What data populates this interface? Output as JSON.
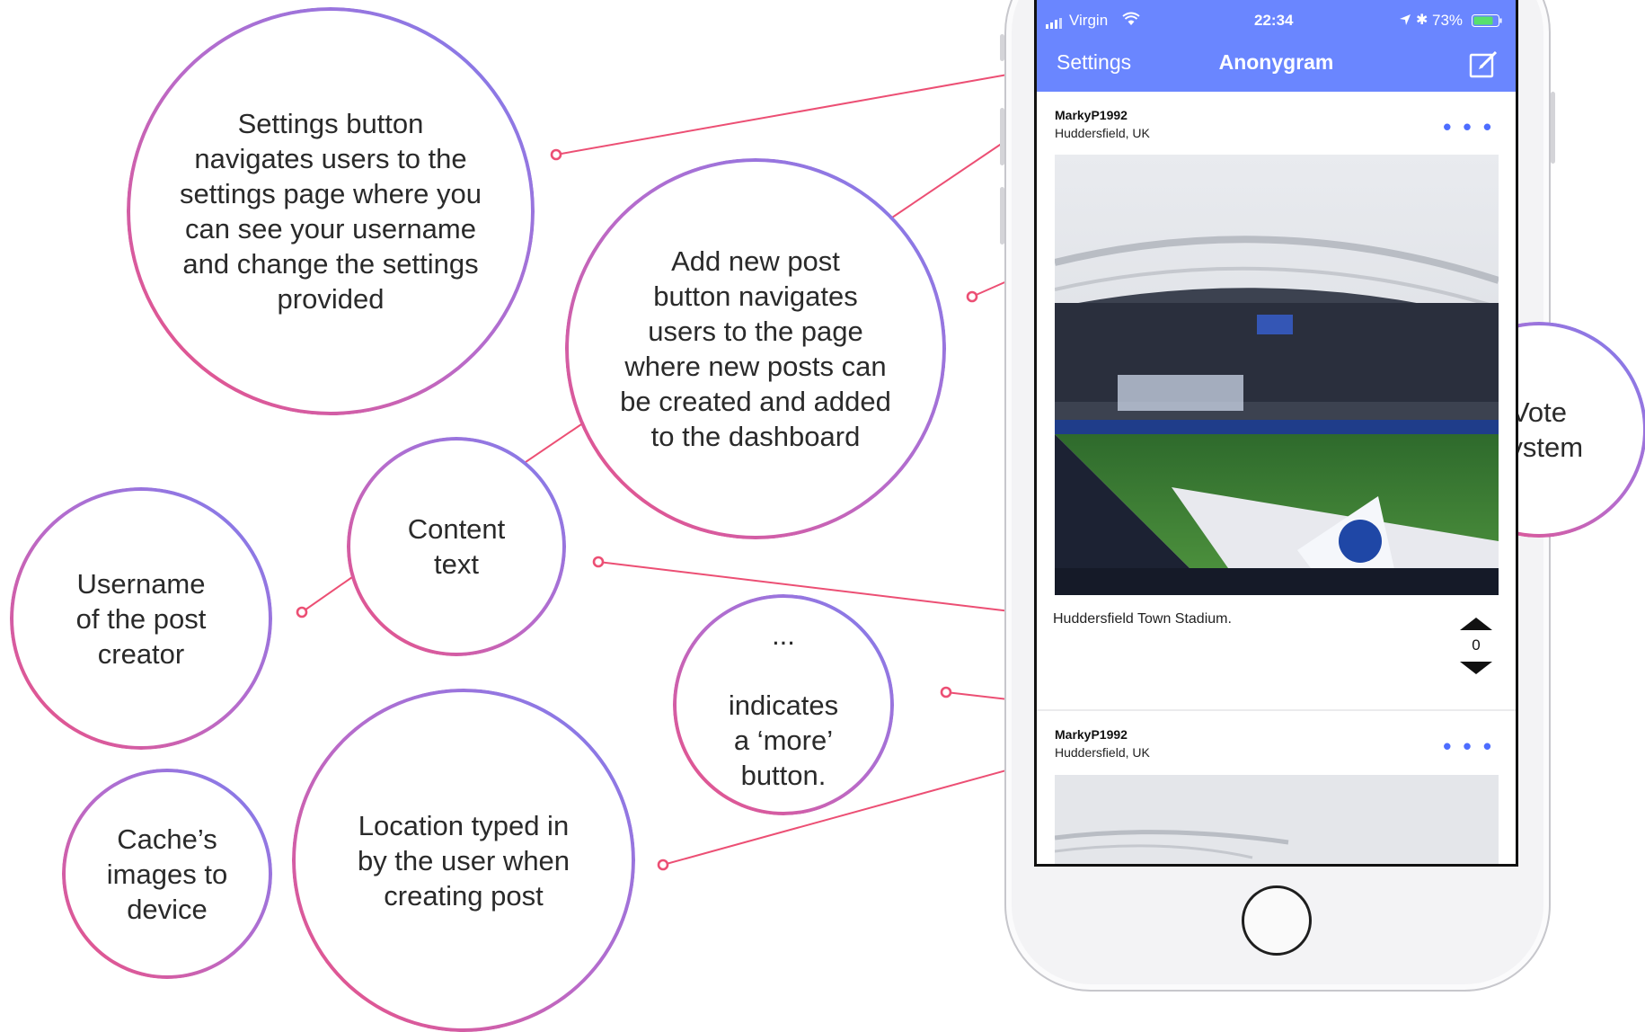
{
  "annotations": {
    "settings": "Settings button\nnavigates users to the\nsettings page where you\ncan see your username\nand change the settings\nprovided",
    "add_post": "Add new post\nbutton navigates\nusers to the page\nwhere new posts can\nbe created and added\nto the dashboard",
    "vote": "Vote\nsystem",
    "content": "Content\ntext",
    "username": "Username\nof the post\ncreator",
    "more": "...\n\nindicates\na ‘more’\nbutton.",
    "cache": "Cache’s\nimages to\ndevice",
    "location": "Location typed in\nby the user when\ncreating post"
  },
  "status_bar": {
    "carrier": "Virgin",
    "time": "22:34",
    "battery": "73%"
  },
  "nav": {
    "left_label": "Settings",
    "title": "Anonygram",
    "compose_icon": "compose-icon"
  },
  "posts": [
    {
      "username": "MarkyP1992",
      "location": "Huddersfield, UK",
      "more": "• • •",
      "caption": "Huddersfield Town Stadium.",
      "votes": "0"
    },
    {
      "username": "MarkyP1992",
      "location": "Huddersfield, UK",
      "more": "• • •"
    }
  ],
  "colors": {
    "accent": "#6a86ff",
    "connector": "#ec4f74",
    "gradient_start": "#ee4f7e",
    "gradient_end": "#7a7ef0"
  }
}
